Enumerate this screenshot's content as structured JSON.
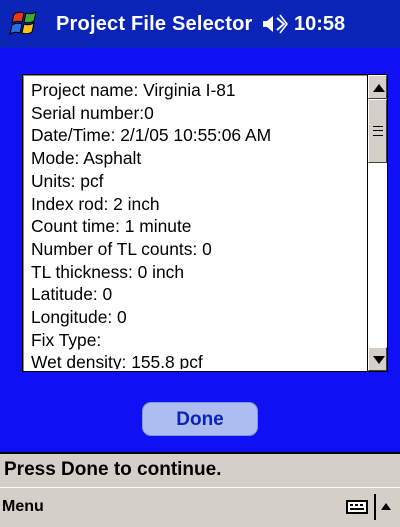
{
  "titlebar": {
    "title": "Project File Selector",
    "time": "10:58",
    "start_icon": "windows-flag-icon",
    "volume_icon": "volume-icon"
  },
  "colors": {
    "titlebar_bg": "#0a24b8",
    "content_bg": "#1010f4",
    "button_bg": "#aebdf0",
    "button_text": "#0a24b8",
    "bar_bg": "#d4d0c8"
  },
  "list": {
    "lines": [
      "Project name: Virginia I-81",
      "Serial number:0",
      "Date/Time: 2/1/05 10:55:06 AM",
      "Mode: Asphalt",
      "Units: pcf",
      "Index rod: 2 inch",
      "Count time: 1 minute",
      "Number of TL counts: 0",
      "TL thickness: 0 inch",
      "Latitude: 0",
      "Longitude: 0",
      "Fix Type:",
      "Wet density: 155.8 pcf"
    ]
  },
  "done_button": {
    "label": "Done"
  },
  "status": {
    "text": "Press Done to continue."
  },
  "menubar": {
    "menu_label": "Menu",
    "keyboard_icon": "keyboard-icon",
    "sip_icon": "chevron-up-icon"
  }
}
